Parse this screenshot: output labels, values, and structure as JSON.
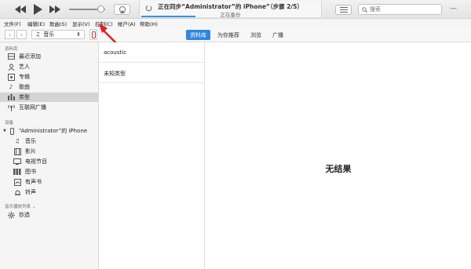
{
  "window": {
    "now_syncing": "正在同步“Administrator”的 iPhone”（步骤 2/5）",
    "status": "正在备份",
    "progress": 0.3
  },
  "search": {
    "placeholder": "搜索"
  },
  "menu": [
    "文件(F)",
    "编辑(E)",
    "歌曲(S)",
    "显示(V)",
    "控制(C)",
    "帐户(A)",
    "帮助(H)"
  ],
  "nav": {
    "media_kind": "音乐",
    "tabs": [
      {
        "label": "资料库",
        "active": true
      },
      {
        "label": "为你推荐",
        "active": false
      },
      {
        "label": "浏览",
        "active": false
      },
      {
        "label": "广播",
        "active": false
      }
    ]
  },
  "sidebar": {
    "library_title": "资料库",
    "library_items": [
      {
        "label": "最近添加",
        "icon": "grid-icon"
      },
      {
        "label": "艺人",
        "icon": "person-icon"
      },
      {
        "label": "专辑",
        "icon": "album-icon"
      },
      {
        "label": "歌曲",
        "icon": "note-icon"
      },
      {
        "label": "类型",
        "icon": "genre-icon",
        "selected": true
      },
      {
        "label": "互联网广播",
        "icon": "radio-icon"
      }
    ],
    "devices_title": "设备",
    "device_name": "“Administrator”的 iPhone",
    "device_items": [
      {
        "label": "音乐",
        "icon": "note-icon"
      },
      {
        "label": "影片",
        "icon": "film-icon"
      },
      {
        "label": "电视节目",
        "icon": "tv-icon"
      },
      {
        "label": "图书",
        "icon": "book-icon"
      },
      {
        "label": "有声书",
        "icon": "audiobook-icon"
      },
      {
        "label": "铃声",
        "icon": "bell-icon"
      }
    ],
    "playlists_title": "音乐播放列表",
    "playlist_items": [
      {
        "label": "妙选",
        "icon": "genius-icon"
      }
    ]
  },
  "genres": [
    "acoustic",
    "未知类型"
  ],
  "empty_message": "无结果",
  "colors": {
    "accent": "#2f87dc",
    "annotation": "#e02020",
    "selected_row": "#d4d4d4"
  }
}
